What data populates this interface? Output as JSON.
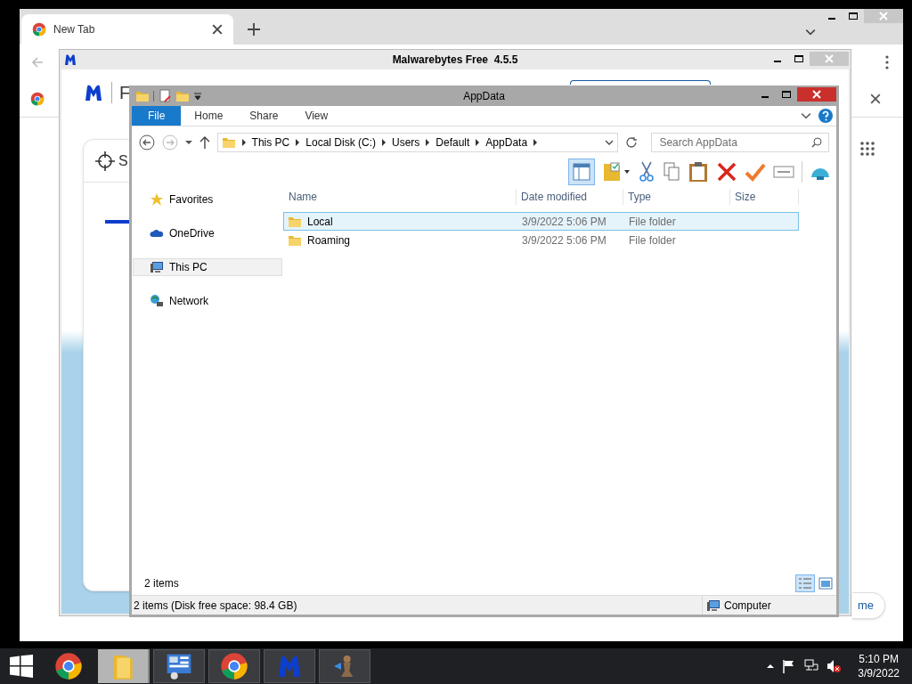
{
  "browser": {
    "tab_title": "New Tab",
    "page_button_text": "me"
  },
  "malwarebytes": {
    "title": "Malwarebytes Free  4.5.5",
    "brand_letter": "F",
    "card_letter": "S"
  },
  "explorer": {
    "title": "AppData",
    "ribbon_tabs": [
      {
        "label": "File",
        "selected": true
      },
      {
        "label": "Home",
        "selected": false
      },
      {
        "label": "Share",
        "selected": false
      },
      {
        "label": "View",
        "selected": false
      }
    ],
    "breadcrumb": [
      "This PC",
      "Local Disk (C:)",
      "Users",
      "Default",
      "AppData"
    ],
    "search": {
      "placeholder": "Search AppData"
    },
    "nav_items": [
      {
        "label": "Favorites",
        "kind": "star",
        "selected": false
      },
      {
        "label": "OneDrive",
        "kind": "cloud",
        "selected": false
      },
      {
        "label": "This PC",
        "kind": "computer",
        "selected": true
      },
      {
        "label": "Network",
        "kind": "network",
        "selected": false
      }
    ],
    "columns": [
      "Name",
      "Date modified",
      "Type",
      "Size"
    ],
    "rows": [
      {
        "name": "Local",
        "date": "3/9/2022 5:06 PM",
        "type": "File folder",
        "selected": true
      },
      {
        "name": "Roaming",
        "date": "3/9/2022 5:06 PM",
        "type": "File folder",
        "selected": false
      }
    ],
    "item_count": "2 items",
    "status_text": "2 items (Disk free space: 98.4 GB)",
    "status_location": "Computer"
  },
  "taskbar": {
    "apps": [
      {
        "kind": "chrome",
        "active": false
      },
      {
        "kind": "folder",
        "active": true
      },
      {
        "kind": "control-panel",
        "active": false
      },
      {
        "kind": "chrome",
        "active": false
      },
      {
        "kind": "malwarebytes",
        "active": false
      },
      {
        "kind": "pawn",
        "active": false
      }
    ],
    "time": "5:10 PM",
    "date": "3/9/2022"
  }
}
